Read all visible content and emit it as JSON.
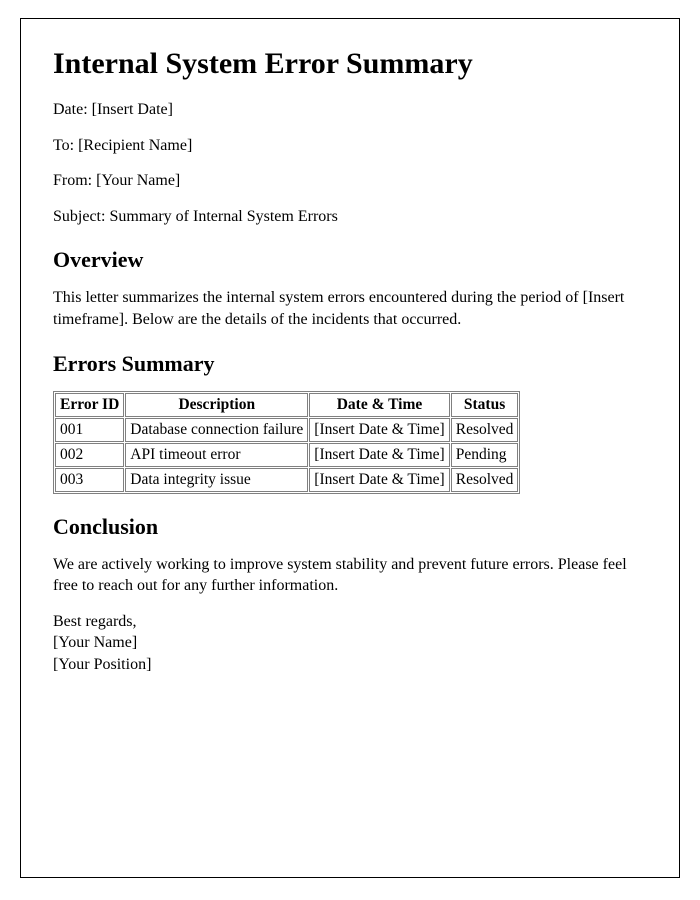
{
  "title": "Internal System Error Summary",
  "meta": {
    "date_line": "Date: [Insert Date]",
    "to_line": "To: [Recipient Name]",
    "from_line": "From: [Your Name]",
    "subject_line": "Subject: Summary of Internal System Errors"
  },
  "overview": {
    "heading": "Overview",
    "body": "This letter summarizes the internal system errors encountered during the period of [Insert timeframe]. Below are the details of the incidents that occurred."
  },
  "errors": {
    "heading": "Errors Summary",
    "columns": {
      "id": "Error ID",
      "description": "Description",
      "datetime": "Date & Time",
      "status": "Status"
    },
    "rows": [
      {
        "id": "001",
        "description": "Database connection failure",
        "datetime": "[Insert Date & Time]",
        "status": "Resolved"
      },
      {
        "id": "002",
        "description": "API timeout error",
        "datetime": "[Insert Date & Time]",
        "status": "Pending"
      },
      {
        "id": "003",
        "description": "Data integrity issue",
        "datetime": "[Insert Date & Time]",
        "status": "Resolved"
      }
    ]
  },
  "conclusion": {
    "heading": "Conclusion",
    "body": "We are actively working to improve system stability and prevent future errors. Please feel free to reach out for any further information."
  },
  "signature": {
    "closing": "Best regards,",
    "name": "[Your Name]",
    "position": "[Your Position]"
  }
}
